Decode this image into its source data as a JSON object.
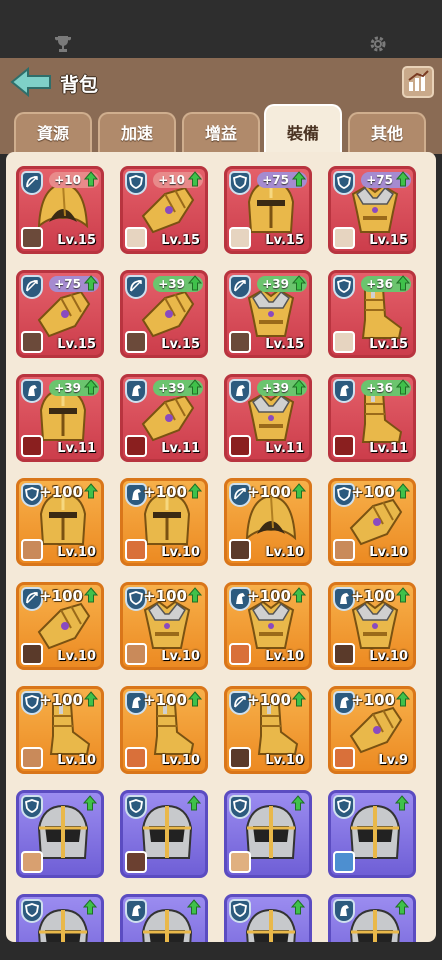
{
  "header": {
    "title": "背包",
    "back_icon": "back-arrow-icon",
    "stats_icon": "stats-chart-icon"
  },
  "topbar": {
    "left_icon": "trophy-icon",
    "right_icon": "gear-icon"
  },
  "tabs": [
    {
      "label": "資源",
      "active": false
    },
    {
      "label": "加速",
      "active": false
    },
    {
      "label": "增益",
      "active": false
    },
    {
      "label": "裝備",
      "active": true
    },
    {
      "label": "其他",
      "active": false
    }
  ],
  "colors": {
    "red": "#cc3d4b",
    "orange": "#ec8a22",
    "purple": "#6f5fd6",
    "panel": "#f4e9d8",
    "header": "#8a6b54"
  },
  "items": [
    {
      "rarity": "red",
      "class": "bow",
      "gear": "hood",
      "bonus": "+10",
      "level": "Lv.15",
      "hero": "#6b4a3a"
    },
    {
      "rarity": "red",
      "class": "shield",
      "gear": "gauntlet",
      "bonus": "+10",
      "level": "Lv.15",
      "hero": "#e6d4c0"
    },
    {
      "rarity": "red",
      "class": "shield",
      "gear": "helmet",
      "bonus": "+75",
      "level": "Lv.15",
      "hero": "#e6d4c0"
    },
    {
      "rarity": "red",
      "class": "shield",
      "gear": "armor",
      "bonus": "+75",
      "level": "Lv.15",
      "hero": "#e6d4c0"
    },
    {
      "rarity": "red",
      "class": "bow",
      "gear": "gauntlet",
      "bonus": "+75",
      "level": "Lv.15",
      "hero": "#6b4a3a"
    },
    {
      "rarity": "red",
      "class": "bow",
      "gear": "gauntlet",
      "bonus": "+39",
      "level": "Lv.15",
      "hero": "#6b4a3a"
    },
    {
      "rarity": "red",
      "class": "bow",
      "gear": "armor",
      "bonus": "+39",
      "level": "Lv.15",
      "hero": "#6b4a3a"
    },
    {
      "rarity": "red",
      "class": "shield",
      "gear": "boots",
      "bonus": "+36",
      "level": "Lv.15",
      "hero": "#e6d4c0"
    },
    {
      "rarity": "red",
      "class": "horse",
      "gear": "helmet",
      "bonus": "+39",
      "level": "Lv.11",
      "hero": "#8a1f1f"
    },
    {
      "rarity": "red",
      "class": "horse",
      "gear": "gauntlet",
      "bonus": "+39",
      "level": "Lv.11",
      "hero": "#8a1f1f"
    },
    {
      "rarity": "red",
      "class": "horse",
      "gear": "armor",
      "bonus": "+39",
      "level": "Lv.11",
      "hero": "#8a1f1f"
    },
    {
      "rarity": "red",
      "class": "horse",
      "gear": "boots",
      "bonus": "+36",
      "level": "Lv.11",
      "hero": "#8a1f1f"
    },
    {
      "rarity": "orange",
      "class": "shield",
      "gear": "helmet",
      "bonus": "+100",
      "level": "Lv.10",
      "hero": "#c98a5a"
    },
    {
      "rarity": "orange",
      "class": "horse",
      "gear": "helmet",
      "bonus": "+100",
      "level": "Lv.10",
      "hero": "#d9703a"
    },
    {
      "rarity": "orange",
      "class": "bow",
      "gear": "hood",
      "bonus": "+100",
      "level": "Lv.10",
      "hero": "#5a3a2a"
    },
    {
      "rarity": "orange",
      "class": "shield",
      "gear": "gauntlet",
      "bonus": "+100",
      "level": "Lv.10",
      "hero": "#c98a5a"
    },
    {
      "rarity": "orange",
      "class": "bow",
      "gear": "gauntlet",
      "bonus": "+100",
      "level": "Lv.10",
      "hero": "#5a3a2a"
    },
    {
      "rarity": "orange",
      "class": "shield",
      "gear": "armor",
      "bonus": "+100",
      "level": "Lv.10",
      "hero": "#c98a5a"
    },
    {
      "rarity": "orange",
      "class": "horse",
      "gear": "armor",
      "bonus": "+100",
      "level": "Lv.10",
      "hero": "#d9703a"
    },
    {
      "rarity": "orange",
      "class": "horse",
      "gear": "armor",
      "bonus": "+100",
      "level": "Lv.10",
      "hero": "#5a3a2a"
    },
    {
      "rarity": "orange",
      "class": "shield",
      "gear": "boots",
      "bonus": "+100",
      "level": "Lv.10",
      "hero": "#c98a5a"
    },
    {
      "rarity": "orange",
      "class": "horse",
      "gear": "boots",
      "bonus": "+100",
      "level": "Lv.10",
      "hero": "#d9703a"
    },
    {
      "rarity": "orange",
      "class": "bow",
      "gear": "boots",
      "bonus": "+100",
      "level": "Lv.10",
      "hero": "#5a3a2a"
    },
    {
      "rarity": "orange",
      "class": "horse",
      "gear": "gauntlet",
      "bonus": "+100",
      "level": "Lv.9",
      "hero": "#d9703a"
    },
    {
      "rarity": "purple",
      "class": "shield",
      "gear": "knight-helm",
      "bonus": "",
      "level": "",
      "hero": "#d8a070"
    },
    {
      "rarity": "purple",
      "class": "shield",
      "gear": "knight-helm",
      "bonus": "",
      "level": "",
      "hero": "#6b4030"
    },
    {
      "rarity": "purple",
      "class": "shield",
      "gear": "knight-helm",
      "bonus": "",
      "level": "",
      "hero": "#e0b080"
    },
    {
      "rarity": "purple",
      "class": "shield",
      "gear": "knight-helm",
      "bonus": "",
      "level": "",
      "hero": "#4d8fd0"
    },
    {
      "rarity": "purple",
      "class": "shield",
      "gear": "knight-helm",
      "bonus": "",
      "level": "",
      "hero": ""
    },
    {
      "rarity": "purple",
      "class": "horse",
      "gear": "knight-helm",
      "bonus": "",
      "level": "",
      "hero": ""
    },
    {
      "rarity": "purple",
      "class": "shield",
      "gear": "knight-helm",
      "bonus": "",
      "level": "",
      "hero": ""
    },
    {
      "rarity": "purple",
      "class": "horse",
      "gear": "knight-helm",
      "bonus": "",
      "level": "",
      "hero": ""
    }
  ]
}
